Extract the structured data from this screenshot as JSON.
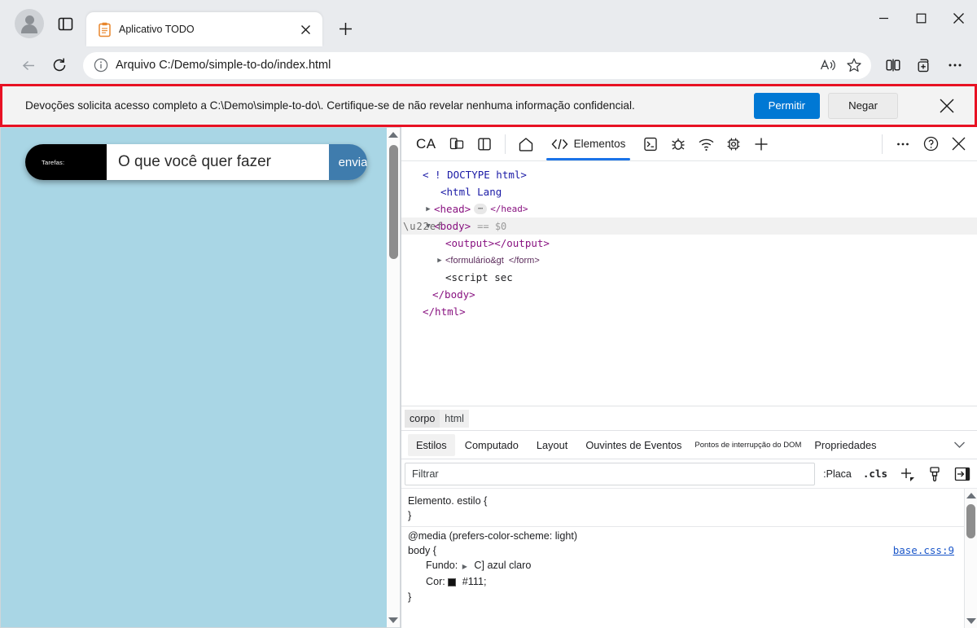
{
  "browser": {
    "tab": {
      "title": "Aplicativo TODO",
      "favicon": "clipboard-icon"
    },
    "new_tab_label": "+",
    "address": {
      "scheme_label": "Arquivo",
      "url": "C:/Demo/simple-to-do/index.html"
    },
    "window_controls": {
      "minimize": "—",
      "maximize": "□",
      "close": "✕"
    }
  },
  "notification": {
    "message": "Devoções solicita acesso completo a C:\\Demo\\simple-to-do\\. Certifique-se de não revelar nenhuma informação confidencial.",
    "allow_label": "Permitir",
    "deny_label": "Negar",
    "accent_color": "#0078d4",
    "border_color": "#e81123"
  },
  "page": {
    "background_color": "#a9d6e5",
    "todo": {
      "label": "Tarefas:",
      "input_value": "",
      "input_placeholder": "O que você quer fazer",
      "submit_label": "enviar",
      "submit_color": "#3f7cad"
    }
  },
  "devtools": {
    "brand": "CA",
    "tabs": [
      {
        "label": "Elementos",
        "active": true
      }
    ],
    "toolbar_icons": [
      "device-toggle-icon",
      "dock-side-icon",
      "home-icon",
      "code-icon",
      "console-icon",
      "bug-icon",
      "network-icon",
      "memory-icon",
      "add-panel-icon",
      "more-options-icon",
      "help-icon",
      "close-icon"
    ],
    "dom": {
      "rows": [
        {
          "indent": 1,
          "twisty": "",
          "text": "< ! DOCTYPE html>",
          "kind": "doctype"
        },
        {
          "indent": 2,
          "twisty": "",
          "text": "<html Lang",
          "kind": "tag"
        },
        {
          "indent": 1,
          "twisty": "▶",
          "text": "<head>",
          "badge": "⋯",
          "tail": "</head>",
          "kind": "tag"
        },
        {
          "indent": 1,
          "twisty": "▼",
          "text": "<body>",
          "marker": "== $0",
          "kind": "tag",
          "selected": true
        },
        {
          "indent": 2,
          "twisty": "",
          "text": "<output></output>",
          "kind": "tag"
        },
        {
          "indent": 2,
          "twisty": "▶",
          "text": "<formulário&gt",
          "tail": "</form>",
          "kind": "small"
        },
        {
          "indent": 2,
          "twisty": "",
          "text": "<script sec",
          "kind": "plain"
        },
        {
          "indent": 1,
          "twisty": "",
          "text": "</body>",
          "kind": "tag"
        },
        {
          "indent": 0,
          "twisty": "",
          "text": "</html>",
          "kind": "tag"
        }
      ]
    },
    "breadcrumb": [
      "corpo",
      "html"
    ],
    "styles_tabs": [
      {
        "label": "Estilos",
        "active": true,
        "tiny": false
      },
      {
        "label": "Computado",
        "active": false,
        "tiny": false
      },
      {
        "label": "Layout",
        "active": false,
        "tiny": false
      },
      {
        "label": "Ouvintes de Eventos",
        "active": false,
        "tiny": false
      },
      {
        "label": "Pontos de interrupção do DOM",
        "active": false,
        "tiny": true
      },
      {
        "label": "Propriedades",
        "active": false,
        "tiny": false
      }
    ],
    "filter": {
      "placeholder": "Filtrar",
      "value": "",
      "hov_label": ":Placa",
      "cls_label": ".cls",
      "icons": [
        "add-rule-icon",
        "copy-styles-icon",
        "sidebar-toggle-icon"
      ]
    },
    "css": {
      "rules": [
        {
          "selector": "Elemento. estilo {",
          "closing": "}",
          "source": "",
          "declarations": []
        },
        {
          "media": "@media (prefers-color-scheme: light)",
          "selector": "body {",
          "closing": "}",
          "source": "base.css:9",
          "declarations": [
            {
              "prop": "Fundo:",
              "value": "C] azul claro",
              "swatch": "lightblue",
              "toggle": true
            },
            {
              "prop": "Cor:",
              "value": "#111;",
              "swatch": "#111111",
              "toggle": false
            }
          ]
        }
      ]
    }
  }
}
